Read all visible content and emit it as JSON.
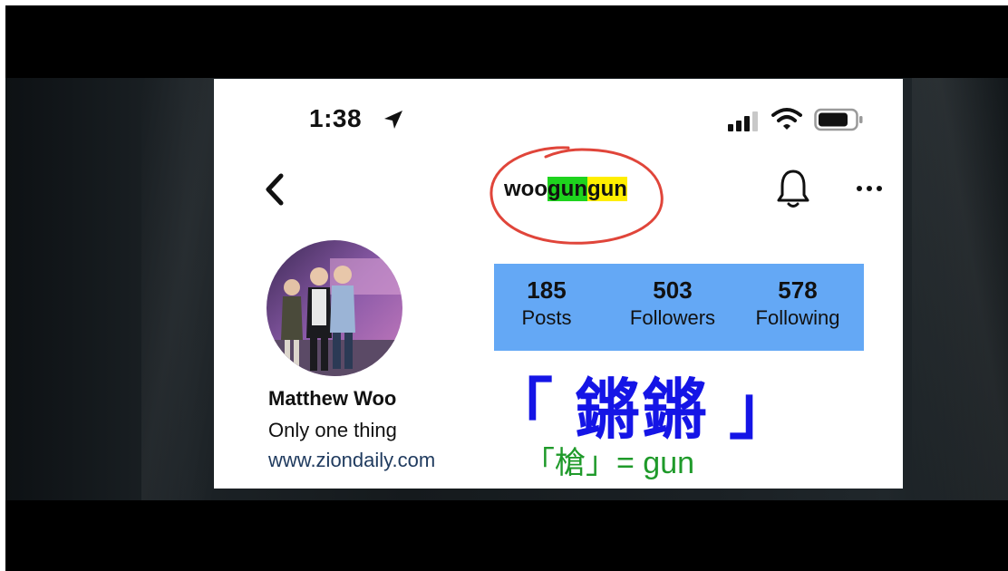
{
  "status_bar": {
    "time": "1:38"
  },
  "header": {
    "username_prefix": "woo",
    "username_green": "gun",
    "username_yellow": "gun"
  },
  "profile": {
    "name": "Matthew Woo",
    "bio": "Only one thing",
    "website": "www.ziondaily.com"
  },
  "stats": [
    {
      "value": "185",
      "label": "Posts"
    },
    {
      "value": "503",
      "label": "Followers"
    },
    {
      "value": "578",
      "label": "Following"
    }
  ],
  "overlay": {
    "main_text": "「 鏘鏘 」",
    "sub_text": "「槍」= gun"
  },
  "colors": {
    "stats_bg": "#64a8f5",
    "highlight_green": "#1ed31e",
    "highlight_yellow": "#ffee00",
    "annotation_circle": "#e0453a",
    "overlay_blue": "#1515e6",
    "overlay_green": "#1f9a2a",
    "link": "#203b5f"
  },
  "icons": [
    "location-arrow-icon",
    "signal-icon",
    "wifi-icon",
    "battery-icon",
    "back-chevron-icon",
    "bell-icon",
    "more-dots-icon"
  ]
}
